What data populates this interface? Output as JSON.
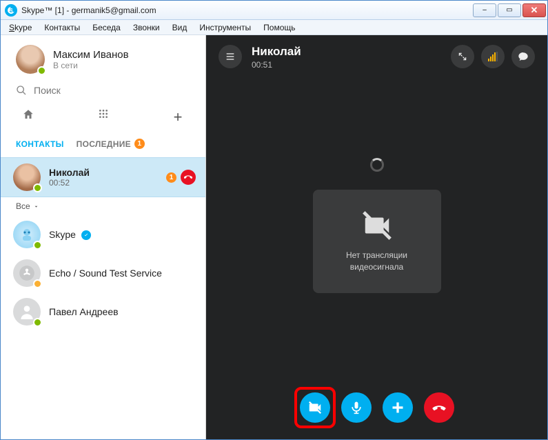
{
  "window": {
    "title": "Skype™ [1] - germanik5@gmail.com",
    "controls": {
      "minimize": "–",
      "maximize": "▭",
      "close": "✕"
    }
  },
  "menubar": {
    "skype": "Skype",
    "contacts": "Контакты",
    "conversation": "Беседа",
    "calls": "Звонки",
    "view": "Вид",
    "tools": "Инструменты",
    "help": "Помощь"
  },
  "profile": {
    "name": "Максим Иванов",
    "status": "В сети"
  },
  "search": {
    "placeholder": "Поиск"
  },
  "tabs": {
    "contacts": "КОНТАКТЫ",
    "recent": "ПОСЛЕДНИЕ",
    "recent_badge": "1"
  },
  "active_contact": {
    "name": "Николай",
    "duration": "00:52",
    "badge": "1"
  },
  "filter": "Все",
  "contacts": [
    {
      "name": "Skype",
      "class": "skype-bot",
      "verified": true,
      "presence": "online"
    },
    {
      "name": "Echo / Sound Test Service",
      "class": "echo",
      "presence": "away"
    },
    {
      "name": "Павел Андреев",
      "class": "default",
      "presence": "online"
    }
  ],
  "call": {
    "menu_tooltip": "list",
    "name": "Николай",
    "duration": "00:51",
    "no_video_line1": "Нет трансляции",
    "no_video_line2": "видеосигнала"
  }
}
